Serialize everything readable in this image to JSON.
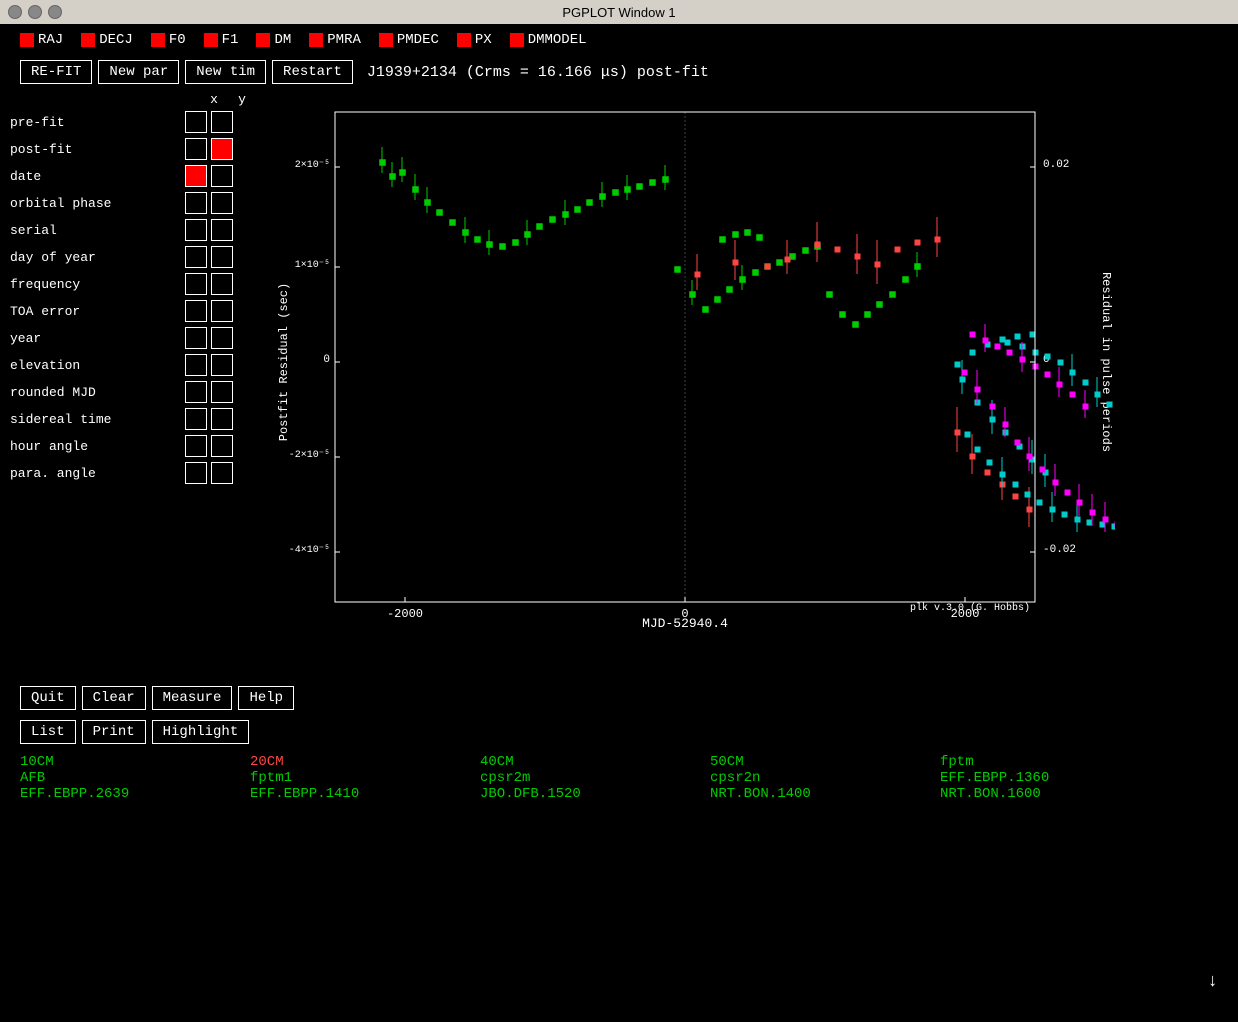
{
  "titlebar": {
    "title": "PGPLOT Window 1"
  },
  "params": [
    {
      "label": "RAJ"
    },
    {
      "label": "DECJ"
    },
    {
      "label": "F0"
    },
    {
      "label": "F1"
    },
    {
      "label": "DM"
    },
    {
      "label": "PMRA"
    },
    {
      "label": "PMDEC"
    },
    {
      "label": "PX"
    },
    {
      "label": "DMMODEL"
    }
  ],
  "toolbar": {
    "refit_label": "RE-FIT",
    "newpar_label": "New par",
    "newtim_label": "New tim",
    "restart_label": "Restart",
    "plot_title": "J1939+2134 (Crms = 16.166 μs) post-fit"
  },
  "rows": [
    {
      "name": "pre-fit",
      "x_state": "empty",
      "y_state": "empty"
    },
    {
      "name": "post-fit",
      "x_state": "empty",
      "y_state": "red"
    },
    {
      "name": "date",
      "x_state": "red",
      "y_state": "empty"
    },
    {
      "name": "orbital phase",
      "x_state": "empty",
      "y_state": "empty"
    },
    {
      "name": "serial",
      "x_state": "empty",
      "y_state": "empty"
    },
    {
      "name": "day of year",
      "x_state": "empty",
      "y_state": "empty"
    },
    {
      "name": "frequency",
      "x_state": "empty",
      "y_state": "empty"
    },
    {
      "name": "TOA error",
      "x_state": "empty",
      "y_state": "empty"
    },
    {
      "name": "year",
      "x_state": "empty",
      "y_state": "empty"
    },
    {
      "name": "elevation",
      "x_state": "empty",
      "y_state": "empty"
    },
    {
      "name": "rounded MJD",
      "x_state": "empty",
      "y_state": "empty"
    },
    {
      "name": "sidereal time",
      "x_state": "empty",
      "y_state": "empty"
    },
    {
      "name": "hour angle",
      "x_state": "empty",
      "y_state": "empty"
    },
    {
      "name": "para. angle",
      "x_state": "empty",
      "y_state": "empty"
    }
  ],
  "axis_labels": [
    "x",
    "y"
  ],
  "plot": {
    "x_axis_label": "MJD-52940.4",
    "y_axis_label_left": "Postfit Residual (sec)",
    "y_axis_label_right": "Residual in pulse periods",
    "x_ticks": [
      "-2000",
      "0",
      "2000"
    ],
    "y_ticks_left": [
      "2×10⁻⁵",
      "0",
      "-2×10⁻⁵",
      "-4×10⁻⁵"
    ],
    "y_ticks_right": [
      "0.02",
      "0",
      "-0.02"
    ],
    "version_label": "plk v.3.0 (G. Hobbs)"
  },
  "bottom_buttons": {
    "row1": [
      {
        "label": "Quit"
      },
      {
        "label": "Clear"
      },
      {
        "label": "Measure"
      },
      {
        "label": "Help"
      }
    ],
    "row2": [
      {
        "label": "List"
      },
      {
        "label": "Print"
      },
      {
        "label": "Highlight"
      }
    ]
  },
  "legend": {
    "items": [
      {
        "label": "10CM",
        "color": "green"
      },
      {
        "label": "20CM",
        "color": "red"
      },
      {
        "label": "40CM",
        "color": "green"
      },
      {
        "label": "50CM",
        "color": "green"
      },
      {
        "label": "fptm",
        "color": "green"
      },
      {
        "label": "AFB",
        "color": "green"
      },
      {
        "label": "fptm1",
        "color": "green"
      },
      {
        "label": "cpsr2m",
        "color": "green"
      },
      {
        "label": "cpsr2n",
        "color": "green"
      },
      {
        "label": "EFF.EBPP.1360",
        "color": "green"
      },
      {
        "label": "EFF.EBPP.2639",
        "color": "green"
      },
      {
        "label": "EFF.EBPP.1410",
        "color": "green"
      },
      {
        "label": "JBO.DFB.1520",
        "color": "green"
      },
      {
        "label": "NRT.BON.1400",
        "color": "green"
      },
      {
        "label": "NRT.BON.1600",
        "color": "green"
      }
    ]
  }
}
